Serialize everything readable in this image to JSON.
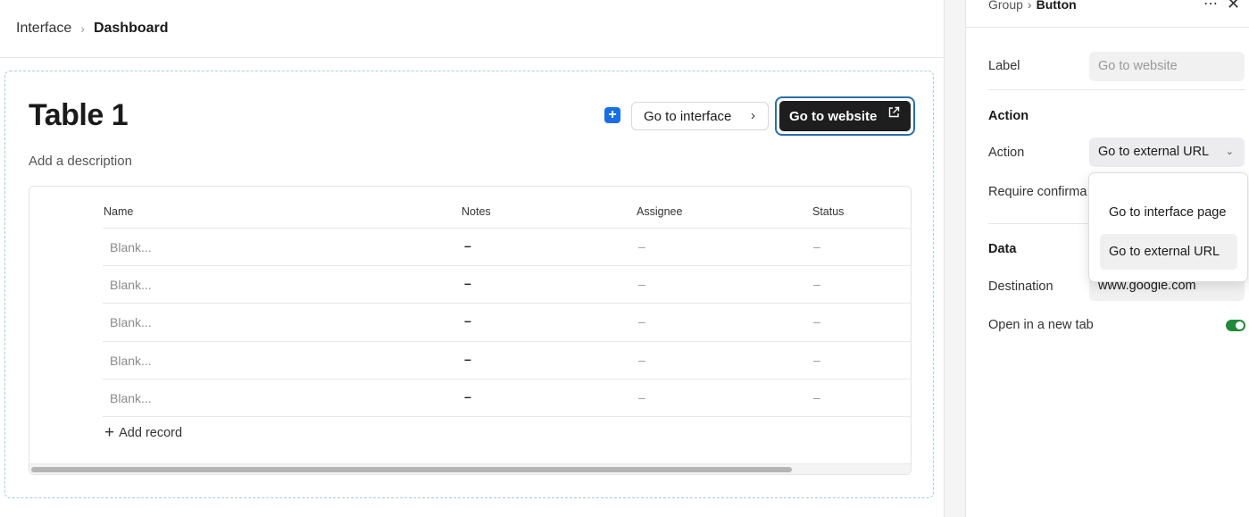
{
  "breadcrumb": {
    "root": "Interface",
    "current": "Dashboard"
  },
  "page": {
    "title": "Table 1",
    "description": "Add a description"
  },
  "buttons": {
    "go_to_interface": "Go to interface",
    "go_to_website": "Go to website"
  },
  "table": {
    "columns": [
      "Name",
      "Notes",
      "Assignee",
      "Status"
    ],
    "rows": [
      {
        "name": "Blank...",
        "notes": "–",
        "assignee": "–",
        "status": "–"
      },
      {
        "name": "Blank...",
        "notes": "–",
        "assignee": "–",
        "status": "–"
      },
      {
        "name": "Blank...",
        "notes": "–",
        "assignee": "–",
        "status": "–"
      },
      {
        "name": "Blank...",
        "notes": "–",
        "assignee": "–",
        "status": "–"
      },
      {
        "name": "Blank...",
        "notes": "–",
        "assignee": "–",
        "status": "–"
      }
    ],
    "add_record": "Add record"
  },
  "panel": {
    "breadcrumb_parent": "Group",
    "breadcrumb_current": "Button",
    "label_label": "Label",
    "label_placeholder": "Go to website",
    "action_section": "Action",
    "action_label": "Action",
    "action_value": "Go to external URL",
    "require_confirmation_label": "Require confirma",
    "data_section": "Data",
    "destination_label": "Destination",
    "destination_value": "www.google.com",
    "open_new_tab_label": "Open in a new tab",
    "open_new_tab_enabled": true
  },
  "dropdown": {
    "options": [
      "Go to interface page",
      "Go to external URL"
    ],
    "selected": "Go to external URL"
  },
  "colors": {
    "accent_blue": "#1a6fe0",
    "toggle_on": "#1f8a3a",
    "primary_button": "#1e1e1e",
    "focus_ring": "#2b6fa8"
  }
}
